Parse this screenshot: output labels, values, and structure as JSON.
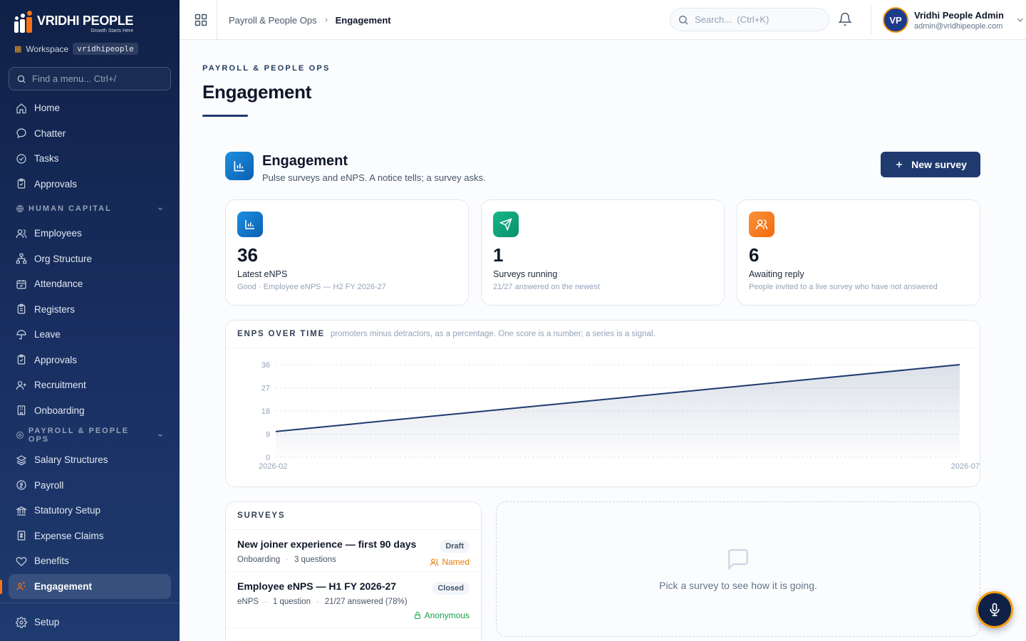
{
  "brand": {
    "name": "VRIDHI PEOPLE",
    "tagline": "Growth Starts Here"
  },
  "workspace": {
    "label": "Workspace",
    "code": "vridhipeople"
  },
  "menu_search": {
    "placeholder": "Find a menu... Ctrl+/"
  },
  "nav": {
    "top": [
      "Home",
      "Chatter",
      "Tasks",
      "Approvals"
    ],
    "human_capital": {
      "label": "HUMAN CAPITAL",
      "items": [
        "Employees",
        "Org Structure",
        "Attendance",
        "Registers",
        "Leave",
        "Approvals",
        "Recruitment",
        "Onboarding"
      ]
    },
    "payroll": {
      "label": "PAYROLL & PEOPLE OPS",
      "items": [
        "Salary Structures",
        "Payroll",
        "Statutory Setup",
        "Expense Claims",
        "Benefits",
        "Engagement"
      ]
    },
    "footer": "Setup"
  },
  "header": {
    "breadcrumb": [
      "Payroll & People Ops",
      "Engagement"
    ],
    "search_placeholder": "Search...  (Ctrl+K)",
    "user": {
      "initials": "VP",
      "name": "Vridhi People Admin",
      "email": "admin@vridhipeople.com"
    }
  },
  "page": {
    "eyebrow": "PAYROLL & PEOPLE OPS",
    "title": "Engagement"
  },
  "section": {
    "title": "Engagement",
    "subtitle": "Pulse surveys and eNPS. A notice tells; a survey asks.",
    "new_button": "New survey"
  },
  "stats": [
    {
      "value": "36",
      "label": "Latest eNPS",
      "note": "Good · Employee eNPS — H2 FY 2026-27",
      "icon": "bar-chart-icon",
      "color": "#0b6fc4"
    },
    {
      "value": "1",
      "label": "Surveys running",
      "note": "21/27 answered on the newest",
      "icon": "send-icon",
      "color": "#10a37f"
    },
    {
      "value": "6",
      "label": "Awaiting reply",
      "note": "People invited to a live survey who have not answered",
      "icon": "users-icon",
      "color": "#f97316"
    }
  ],
  "chart": {
    "title": "ENPS OVER TIME",
    "subtitle": "promoters minus detractors, as a percentage. One score is a number; a series is a signal."
  },
  "chart_data": {
    "type": "area",
    "x": [
      "2026-02",
      "2026-07"
    ],
    "values": [
      10,
      36
    ],
    "xlabel": "",
    "ylabel": "",
    "yticks": [
      0,
      9,
      18,
      27,
      36
    ],
    "ylim": [
      0,
      36
    ],
    "grid": true,
    "line_color": "#1e3a6e"
  },
  "surveys": {
    "heading": "SURVEYS",
    "items": [
      {
        "title": "New joiner experience — first 90 days",
        "status": "Draft",
        "meta": [
          "Onboarding",
          "3 questions"
        ],
        "privacy": "Named"
      },
      {
        "title": "Employee eNPS — H1 FY 2026-27",
        "status": "Closed",
        "meta": [
          "eNPS",
          "1 question",
          "21/27 answered (78%)"
        ],
        "privacy": "Anonymous"
      }
    ]
  },
  "empty": {
    "text": "Pick a survey to see how it is going."
  }
}
